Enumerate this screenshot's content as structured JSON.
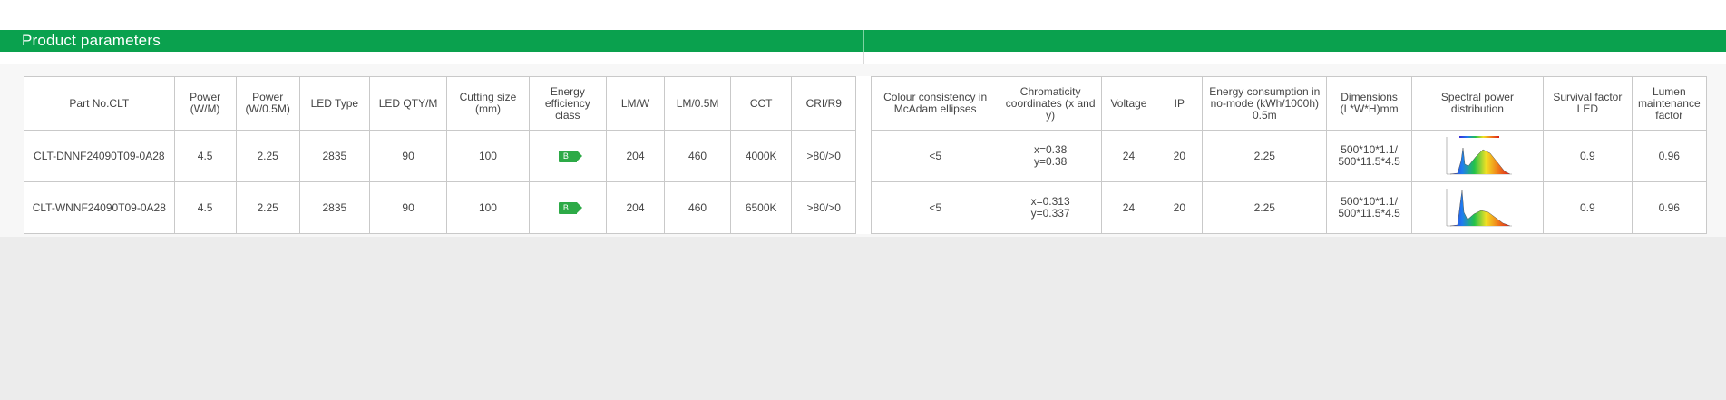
{
  "section": {
    "title": "Product parameters"
  },
  "table": {
    "headers": [
      "Part No.CLT",
      "Power (W/M)",
      "Power (W/0.5M)",
      "LED Type",
      "LED QTY/M",
      "Cutting size (mm)",
      "Energy efficiency class",
      "LM/W",
      "LM/0.5M",
      "CCT",
      "CRI/R9",
      "Colour consistency in McAdam ellipses",
      "Chromaticity coordinates (x and y)",
      "Voltage",
      "IP",
      "Energy consumption in no-mode (kWh/1000h) 0.5m",
      "Dimensions (L*W*H)mm",
      "Spectral power distribution",
      "Survival factor LED",
      "Lumen maintenance factor"
    ],
    "rows": [
      {
        "part_no": "CLT-DNNF24090T09-0A28",
        "power_m": "4.5",
        "power_half": "2.25",
        "led_type": "2835",
        "led_qty": "90",
        "cutting": "100",
        "energy_class": "B",
        "lm_w": "204",
        "lm_half": "460",
        "cct": "4000K",
        "cri": ">80/>0",
        "mcadam": "<5",
        "chroma_x": "x=0.38",
        "chroma_y": "y=0.38",
        "voltage": "24",
        "ip": "20",
        "energy_nomode": "2.25",
        "dim_1": "500*10*1.1/",
        "dim_2": "500*11.5*4.5",
        "spectrum_icon": "spectral-chart-icon",
        "survival": "0.9",
        "lumen_maint": "0.96"
      },
      {
        "part_no": "CLT-WNNF24090T09-0A28",
        "power_m": "4.5",
        "power_half": "2.25",
        "led_type": "2835",
        "led_qty": "90",
        "cutting": "100",
        "energy_class": "B",
        "lm_w": "204",
        "lm_half": "460",
        "cct": "6500K",
        "cri": ">80/>0",
        "mcadam": "<5",
        "chroma_x": "x=0.313",
        "chroma_y": "y=0.337",
        "voltage": "24",
        "ip": "20",
        "energy_nomode": "2.25",
        "dim_1": "500*10*1.1/",
        "dim_2": "500*11.5*4.5",
        "spectrum_icon": "spectral-chart-icon",
        "survival": "0.9",
        "lumen_maint": "0.96"
      }
    ]
  },
  "colors": {
    "brand_green": "#0aa14e",
    "badge_green": "#2daa47",
    "border": "#c9c9c9"
  }
}
